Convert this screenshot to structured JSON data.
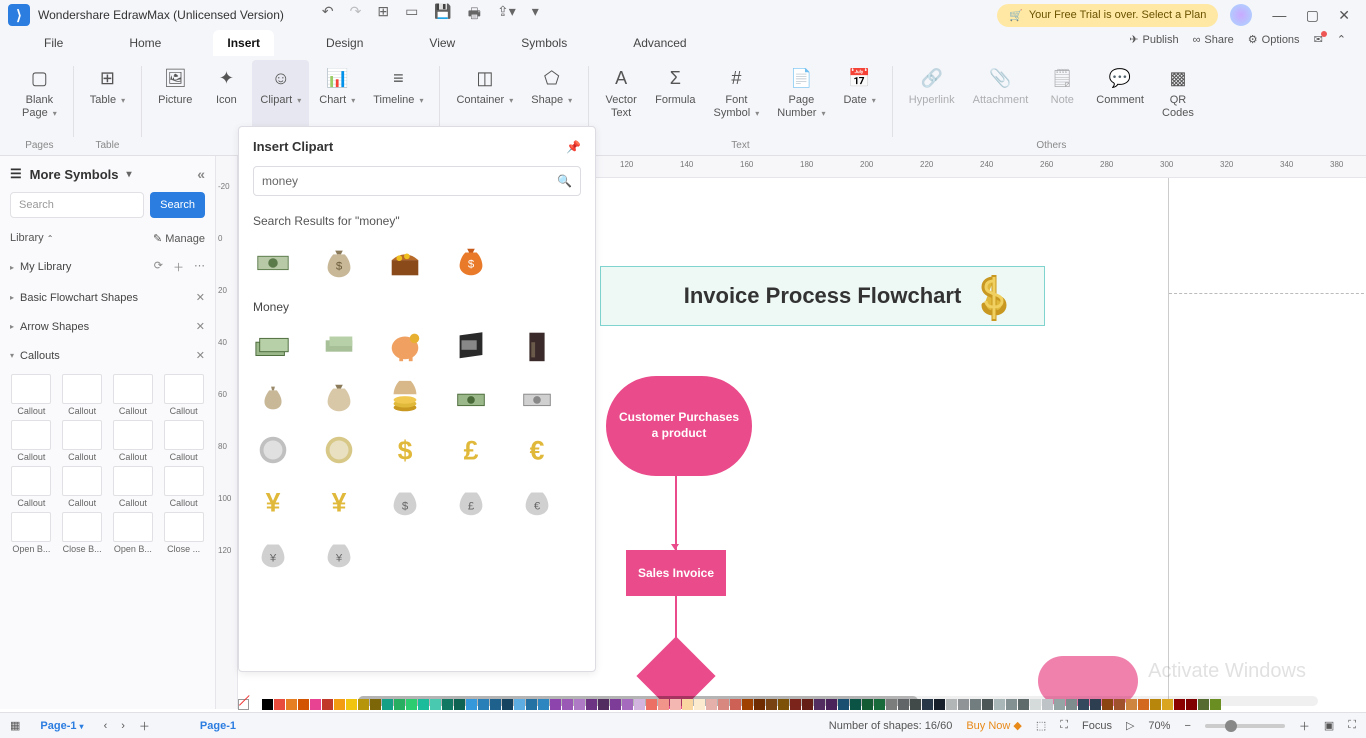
{
  "titlebar": {
    "app_name": "Wondershare EdrawMax (Unlicensed Version)",
    "trial_text": "Your Free Trial is over. Select a Plan"
  },
  "menubar": {
    "tabs": [
      "File",
      "Home",
      "Insert",
      "Design",
      "View",
      "Symbols",
      "Advanced"
    ],
    "active": "Insert",
    "right": {
      "publish": "Publish",
      "share": "Share",
      "options": "Options"
    }
  },
  "ribbon": {
    "groups": [
      {
        "label": "Pages",
        "items": [
          {
            "name": "Blank\nPage",
            "caret": true
          }
        ]
      },
      {
        "label": "Table",
        "items": [
          {
            "name": "Table",
            "caret": true
          }
        ]
      },
      {
        "label": "",
        "items": [
          {
            "name": "Picture"
          },
          {
            "name": "Icon"
          },
          {
            "name": "Clipart",
            "active": true,
            "caret": true
          },
          {
            "name": "Chart",
            "caret": true
          },
          {
            "name": "Timeline",
            "caret": true
          }
        ]
      },
      {
        "label": "",
        "items": [
          {
            "name": "Container",
            "caret": true
          },
          {
            "name": "Shape",
            "caret": true
          }
        ]
      },
      {
        "label": "Text",
        "items": [
          {
            "name": "Vector\nText"
          },
          {
            "name": "Formula"
          },
          {
            "name": "Font\nSymbol",
            "caret": true
          },
          {
            "name": "Page\nNumber",
            "caret": true
          },
          {
            "name": "Date",
            "caret": true
          }
        ]
      },
      {
        "label": "Others",
        "items": [
          {
            "name": "Hyperlink",
            "disabled": true
          },
          {
            "name": "Attachment",
            "disabled": true
          },
          {
            "name": "Note",
            "disabled": true
          },
          {
            "name": "Comment"
          },
          {
            "name": "QR\nCodes"
          }
        ]
      }
    ]
  },
  "sidebar": {
    "title": "More Symbols",
    "search_placeholder": "Search",
    "search_btn": "Search",
    "library_label": "Library",
    "manage_label": "Manage",
    "cats": [
      {
        "label": "My Library",
        "icons": true
      },
      {
        "label": "Basic Flowchart Shapes",
        "x": true
      },
      {
        "label": "Arrow Shapes",
        "x": true
      },
      {
        "label": "Callouts",
        "open": true,
        "x": true
      }
    ],
    "callout_names": [
      "Callout",
      "Callout",
      "Callout",
      "Callout",
      "Callout",
      "Callout",
      "Callout",
      "Callout",
      "Callout",
      "Callout",
      "Callout",
      "Callout",
      "Open B...",
      "Close B...",
      "Open B...",
      "Close ..."
    ]
  },
  "clipart": {
    "title": "Insert Clipart",
    "query": "money",
    "results_label": "Search Results for  \"money\"",
    "category_label": "Money"
  },
  "canvas": {
    "title_text": "Invoice Process Flowchart",
    "start_text": "Customer Purchases a product",
    "rect_text": "Sales Invoice"
  },
  "hruler_ticks": [
    620,
    680,
    740,
    800,
    860,
    920,
    980,
    1040,
    1100,
    1160,
    1220,
    1280
  ],
  "hruler_vals": [
    "120",
    "140",
    "160",
    "180",
    "200",
    "220",
    "240",
    "260",
    "280",
    "300",
    "320",
    "340"
  ],
  "hruler_extra": {
    "pos": 1330,
    "val": "380"
  },
  "vruler": [
    {
      "pos": 26,
      "val": "-20"
    },
    {
      "pos": 78,
      "val": "0"
    },
    {
      "pos": 130,
      "val": "20"
    },
    {
      "pos": 182,
      "val": "40"
    },
    {
      "pos": 234,
      "val": "60"
    },
    {
      "pos": 286,
      "val": "80"
    },
    {
      "pos": 338,
      "val": "100"
    },
    {
      "pos": 390,
      "val": "120"
    }
  ],
  "watermark": "Activate Windows",
  "swatches": [
    "#fff",
    "#000",
    "#e74c3c",
    "#e67e22",
    "#d35400",
    "#e84393",
    "#c0392b",
    "#f39c12",
    "#f1c40f",
    "#b7950b",
    "#7d6608",
    "#16a085",
    "#27ae60",
    "#2ecc71",
    "#1abc9c",
    "#48c9b0",
    "#117864",
    "#0e6251",
    "#3498db",
    "#2980b9",
    "#1f618d",
    "#154360",
    "#5dade2",
    "#2471a3",
    "#2e86c1",
    "#8e44ad",
    "#9b59b6",
    "#af7ac5",
    "#6c3483",
    "#512e5f",
    "#7d3c98",
    "#a569bd",
    "#d2b4de",
    "#ec7063",
    "#f1948a",
    "#f5b7b1",
    "#fad7a0",
    "#fdebd0",
    "#e6b0aa",
    "#d98880",
    "#cd6155",
    "#a04000",
    "#6e2c00",
    "#784212",
    "#7e5109",
    "#7b241c",
    "#641e16",
    "#512e5f",
    "#4a235a",
    "#1b4f72",
    "#0b5345",
    "#145a32",
    "#186a3b",
    "#7b7d7d",
    "#626567",
    "#424949",
    "#283747",
    "#17202a",
    "#b3b6b7",
    "#909497",
    "#717d7e",
    "#4d5656",
    "#aab7b8",
    "#839192",
    "#5f6a6a",
    "#d5dbdb",
    "#bdc3c7",
    "#95a5a6",
    "#7f8c8d",
    "#34495e",
    "#2c3e50",
    "#8b4513",
    "#a0522d",
    "#cd853f",
    "#d2691e",
    "#b8860b",
    "#daa520",
    "#8b0000",
    "#800000",
    "#556b2f",
    "#6b8e23"
  ],
  "status": {
    "page_tab": "Page-1",
    "shapes": "Number of shapes: 16/60",
    "buy": "Buy Now",
    "focus": "Focus",
    "zoom": "70%"
  }
}
